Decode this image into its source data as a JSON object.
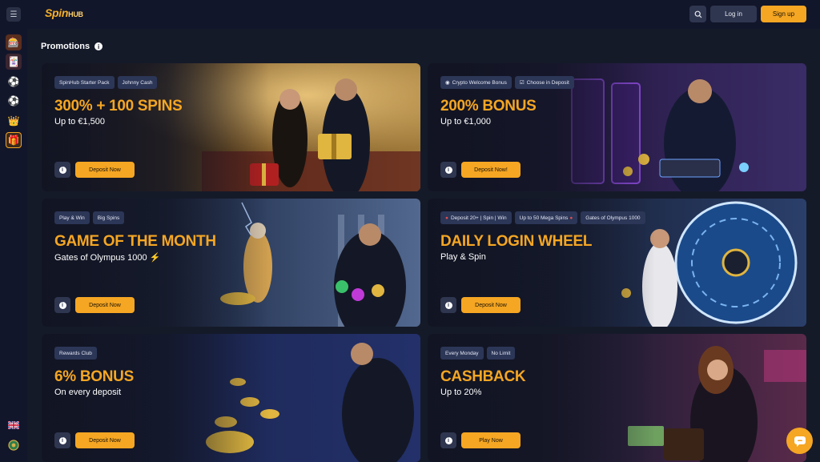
{
  "header": {
    "logo_spin": "Spin",
    "logo_hub": "HUB",
    "login_label": "Log in",
    "signup_label": "Sign up"
  },
  "page": {
    "title": "Promotions"
  },
  "sidebar": {
    "items": [
      {
        "icon": "casino-icon"
      },
      {
        "icon": "cards-icon"
      },
      {
        "icon": "soccer-ball-icon"
      },
      {
        "icon": "live-sports-icon"
      },
      {
        "icon": "crown-icon"
      },
      {
        "icon": "gift-icon",
        "active": true
      }
    ],
    "bottom": [
      {
        "icon": "uk-flag-icon"
      },
      {
        "icon": "coin-icon"
      }
    ]
  },
  "promotions": [
    {
      "tags": [
        "SpinHub Starter Pack",
        "Johnny Cash"
      ],
      "title": "300% + 100 SPINS",
      "subtitle": "Up to €1,500",
      "cta": "Deposit Now"
    },
    {
      "tags": [
        "Crypto Welcome Bonus",
        "Choose in Deposit"
      ],
      "title": "200% BONUS",
      "subtitle": "Up to €1,000",
      "cta": "Deposit Now!"
    },
    {
      "tags": [
        "Play & Win",
        "Big Spins"
      ],
      "title": "GAME OF THE MONTH",
      "subtitle": "Gates of Olympus 1000 ⚡",
      "cta": "Deposit Now"
    },
    {
      "tags": [
        "Deposit 20+ | Spin | Win",
        "Up to 50 Mega Spins",
        "Gates of Olympus 1000"
      ],
      "title": "DAILY LOGIN WHEEL",
      "subtitle": "Play & Spin",
      "cta": "Deposit Now"
    },
    {
      "tags": [
        "Rewards Club"
      ],
      "title": "6% BONUS",
      "subtitle": "On every deposit",
      "cta": "Deposit Now"
    },
    {
      "tags": [
        "Every Monday",
        "No Limit"
      ],
      "title": "CASHBACK",
      "subtitle": "Up to 20%",
      "cta": "Play Now"
    }
  ],
  "colors": {
    "background": "#151a29",
    "accent": "#f5a623",
    "tag_bg": "#2c3657"
  }
}
